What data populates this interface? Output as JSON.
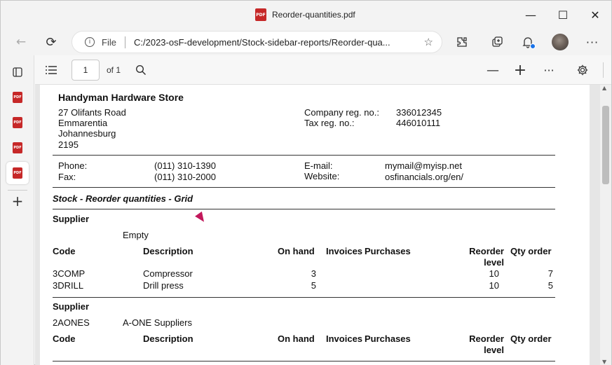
{
  "window": {
    "title": "Reorder-quantities.pdf",
    "minimize_glyph": "—",
    "maximize_glyph": "☐",
    "close_glyph": "✕"
  },
  "browser": {
    "back_glyph": "←",
    "refresh_glyph": "⟳",
    "file_label": "File",
    "url": "C:/2023-osF-development/Stock-sidebar-reports/Reorder-qua...",
    "icons": [
      "extensions-icon",
      "collections-icon",
      "notifications-icon",
      "profile-avatar",
      "more-options-icon"
    ]
  },
  "sidebar": {
    "items": [
      "tab-actions-icon",
      "pdf-tab",
      "pdf-tab",
      "pdf-tab",
      "pdf-tab-active",
      "new-tab-icon"
    ],
    "pdf_badge": "PDF"
  },
  "pdf_toolbar": {
    "page_number": "1",
    "of_pages": "of 1"
  },
  "document": {
    "company_name": "Handyman Hardware Store",
    "address": [
      "27 Olifants Road",
      "Emmarentia",
      "Johannesburg",
      "2195"
    ],
    "company_reg_label": "Company reg. no.:",
    "company_reg_value": "336012345",
    "tax_reg_label": "Tax reg. no.:",
    "tax_reg_value": "446010111",
    "phone_label": "Phone:",
    "phone_value": "(011) 310-1390",
    "fax_label": "Fax:",
    "fax_value": "(011) 310-2000",
    "email_label": "E-mail:",
    "email_value": "mymail@myisp.net",
    "website_label": "Website:",
    "website_value": "osfinancials.org/en/",
    "report_title": "Stock - Reorder quantities - Grid",
    "columns": {
      "code": "Code",
      "description": "Description",
      "on_hand": "On hand",
      "invoices": "Invoices",
      "purchases": "Purchases",
      "reorder_level": [
        "Reorder",
        "level"
      ],
      "qty_order": "Qty order"
    },
    "groups": [
      {
        "label": "Supplier",
        "supplier_code": "",
        "supplier_name": "Empty",
        "rows": [
          {
            "code": "3COMP",
            "description": "Compressor",
            "on_hand": "3",
            "invoices": "",
            "purchases": "",
            "reorder_level": "10",
            "qty_order": "7"
          },
          {
            "code": "3DRILL",
            "description": "Drill press",
            "on_hand": "5",
            "invoices": "",
            "purchases": "",
            "reorder_level": "10",
            "qty_order": "5"
          }
        ]
      },
      {
        "label": "Supplier",
        "supplier_code": "2AONES",
        "supplier_name": "A-ONE Suppliers",
        "rows": []
      }
    ]
  }
}
